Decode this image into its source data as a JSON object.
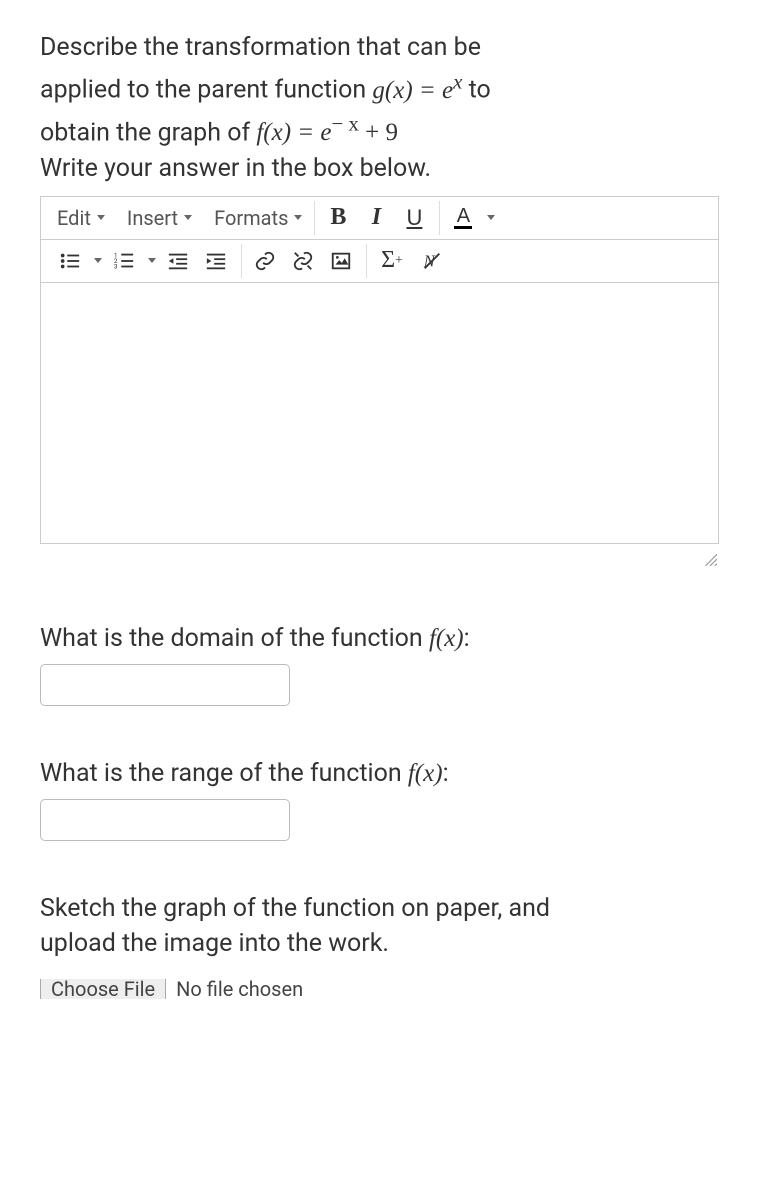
{
  "question": {
    "line1_pre": "Describe the transformation that can be",
    "line2_pre": "applied to the parent function ",
    "g_expr": "g(x) = e",
    "g_exp": "x",
    "line2_post": " to",
    "line3_pre": "obtain the graph of ",
    "f_expr_a": "f(x) = e",
    "f_exp": "− x",
    "f_expr_b": " + 9",
    "line4": "Write your answer in the box below."
  },
  "toolbar": {
    "edit": "Edit",
    "insert": "Insert",
    "formats": "Formats",
    "bold": "B",
    "italic": "I",
    "underline": "U",
    "color_letter": "A",
    "sigma": "Σ",
    "sigma_plus": "+"
  },
  "q_domain": {
    "pre": "What is the domain of the function ",
    "fx": "f(x)",
    "post": ":"
  },
  "q_range": {
    "pre": "What is the range of the function ",
    "fx": "f(x)",
    "post": ":"
  },
  "q_sketch": {
    "line1": "Sketch the graph of the function on paper, and",
    "line2": "upload the image into the work."
  },
  "file": {
    "button": "Choose File",
    "status": "No file chosen"
  }
}
